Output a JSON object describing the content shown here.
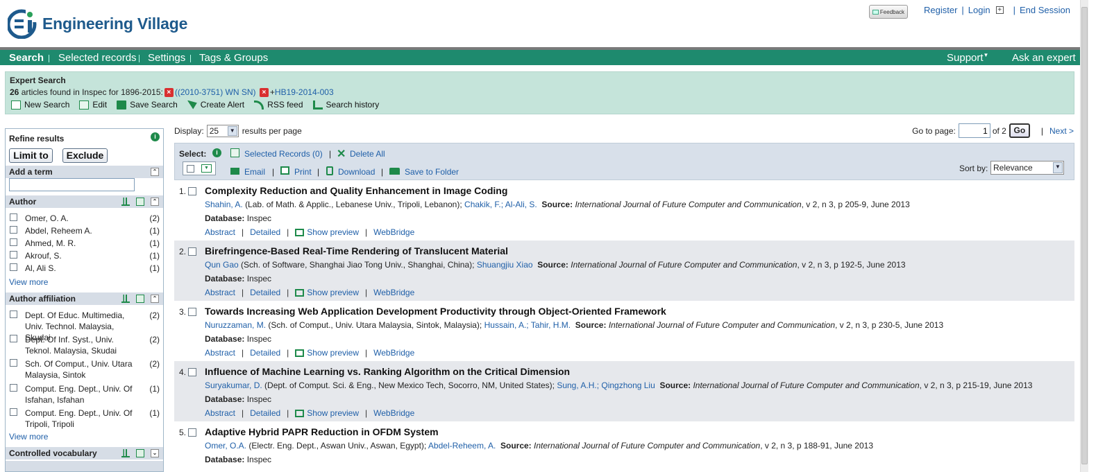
{
  "app": {
    "name": "Engineering Village"
  },
  "top_links": {
    "feedback": "Feedback",
    "register": "Register",
    "login": "Login",
    "end_session": "End Session",
    "sep": "|"
  },
  "nav": {
    "search": "Search",
    "selected_records": "Selected records",
    "settings": "Settings",
    "tags_groups": "Tags & Groups",
    "support": "Support",
    "ask_expert": "Ask an expert"
  },
  "summary": {
    "title": "Expert Search",
    "count": "26",
    "found_text": "articles found in Inspec for 1896-2015:",
    "term1": "((2010-3751) WN SN)",
    "plus": "+",
    "term2": "HB19-2014-003",
    "tools": {
      "new_search": "New Search",
      "edit": "Edit",
      "save_search": "Save Search",
      "create_alert": "Create Alert",
      "rss_feed": "RSS feed",
      "search_history": "Search history"
    }
  },
  "refine": {
    "title": "Refine results",
    "limit_to": "Limit to",
    "exclude": "Exclude",
    "add_term": "Add a term",
    "author": {
      "title": "Author",
      "items": [
        {
          "label": "Omer, O. A.",
          "count": "(2)"
        },
        {
          "label": "Abdel, Reheem A.",
          "count": "(1)"
        },
        {
          "label": "Ahmed, M. R.",
          "count": "(1)"
        },
        {
          "label": "Akrouf, S.",
          "count": "(1)"
        },
        {
          "label": "Al, Ali S.",
          "count": "(1)"
        }
      ]
    },
    "affiliation": {
      "title": "Author affiliation",
      "items": [
        {
          "label": "Dept. Of Educ. Multimedia, Univ. Technol. Malaysia, Skudai",
          "count": "(2)"
        },
        {
          "label": "Dept. Of Inf. Syst., Univ. Teknol. Malaysia, Skudai",
          "count": "(2)"
        },
        {
          "label": "Sch. Of Comput., Univ. Utara Malaysia, Sintok",
          "count": "(2)"
        },
        {
          "label": "Comput. Eng. Dept., Univ. Of Isfahan, Isfahan",
          "count": "(1)"
        },
        {
          "label": "Comput. Eng. Dept., Univ. Of Tripoli, Tripoli",
          "count": "(1)"
        }
      ]
    },
    "view_more": "View more",
    "controlled_vocab": "Controlled vocabulary"
  },
  "display": {
    "label": "Display:",
    "value": "25",
    "suffix": "results per page"
  },
  "pager": {
    "goto_label": "Go to page:",
    "page": "1",
    "of": "of 2",
    "go": "Go",
    "next": "Next >"
  },
  "toolbar": {
    "select": "Select:",
    "selected_records": "Selected Records (0)",
    "delete_all": "Delete All",
    "email": "Email",
    "print": "Print",
    "download": "Download",
    "save_folder": "Save to Folder",
    "sort_by": "Sort by:",
    "sort_value": "Relevance"
  },
  "labels": {
    "database": "Database:",
    "source": "Source:",
    "abstract": "Abstract",
    "detailed": "Detailed",
    "show_preview": "Show preview",
    "webbridge": "WebBridge"
  },
  "results": [
    {
      "num": "1.",
      "title": "Complexity Reduction and Quality Enhancement in Image Coding",
      "a1": "Shahin, A.",
      "aff1": "(Lab. of Math. & Applic., Lebanese Univ., Tripoli, Lebanon);",
      "a2": "Chakik, F.;",
      "a3": "Al-Ali, S.",
      "journal": "International Journal of Future Computer and Communication",
      "details": ", v 2, n 3, p 205-9, June 2013",
      "db": "Inspec"
    },
    {
      "num": "2.",
      "title": "Birefringence-Based Real-Time Rendering of Translucent Material",
      "a1": "Qun Gao",
      "aff1": "(Sch. of Software, Shanghai Jiao Tong Univ., Shanghai, China);",
      "a2": "Shuangjiu Xiao",
      "a3": "",
      "journal": "International Journal of Future Computer and Communication",
      "details": ", v 2, n 3, p 192-5, June 2013",
      "db": "Inspec"
    },
    {
      "num": "3.",
      "title": "Towards Increasing Web Application Development Productivity through Object-Oriented Framework",
      "a1": "Nuruzzaman, M.",
      "aff1": "(Sch. of Comput., Univ. Utara Malaysia, Sintok, Malaysia);",
      "a2": "Hussain, A.;",
      "a3": "Tahir, H.M.",
      "journal": "International Journal of Future Computer and Communication",
      "details": ", v 2, n 3, p 230-5, June 2013",
      "db": "Inspec"
    },
    {
      "num": "4.",
      "title": "Influence of Machine Learning vs. Ranking Algorithm on the Critical Dimension",
      "a1": "Suryakumar, D.",
      "aff1": "(Dept. of Comput. Sci. & Eng., New Mexico Tech, Socorro, NM, United States);",
      "a2": "Sung, A.H.;",
      "a3": "Qingzhong Liu",
      "journal": "International Journal of Future Computer and Communication",
      "details": ", v 2, n 3, p 215-19, June 2013",
      "db": "Inspec"
    },
    {
      "num": "5.",
      "title": "Adaptive Hybrid PAPR Reduction in OFDM System",
      "a1": "Omer, O.A.",
      "aff1": "(Electr. Eng. Dept., Aswan Univ., Aswan, Egypt);",
      "a2": "Abdel-Reheem, A.",
      "a3": "",
      "journal": "International Journal of Future Computer and Communication",
      "details": ", v 2, n 3, p 188-91, June 2013",
      "db": "Inspec"
    }
  ],
  "colors": {
    "nav_green": "#1e8a6e",
    "summary_bg": "#c5e4da",
    "link_blue": "#1f5fa8",
    "facet_header": "#d6dde6"
  }
}
